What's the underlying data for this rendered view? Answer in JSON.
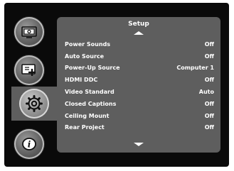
{
  "panel": {
    "title": "Setup"
  },
  "nav": [
    {
      "name": "picture-menu-button",
      "icon": "picture-monitor-icon",
      "selected": false
    },
    {
      "name": "settings-menu-button",
      "icon": "screen-plus-icon",
      "selected": false
    },
    {
      "name": "setup-menu-button",
      "icon": "gear-icon",
      "selected": true
    },
    {
      "name": "info-menu-button",
      "icon": "info-icon",
      "selected": false
    }
  ],
  "menu": {
    "items": [
      {
        "label": "Power Sounds",
        "value": "Off"
      },
      {
        "label": "Auto Source",
        "value": "Off"
      },
      {
        "label": "Power-Up Source",
        "value": "Computer 1"
      },
      {
        "label": "HDMI DDC",
        "value": "Off"
      },
      {
        "label": "Video Standard",
        "value": "Auto"
      },
      {
        "label": "Closed Captions",
        "value": "Off"
      },
      {
        "label": "Ceiling Mount",
        "value": "Off"
      },
      {
        "label": "Rear Project",
        "value": "Off"
      }
    ]
  },
  "colors": {
    "frame": "#0a0a0a",
    "panel": "#5e5e5e",
    "text": "#ffffff"
  }
}
